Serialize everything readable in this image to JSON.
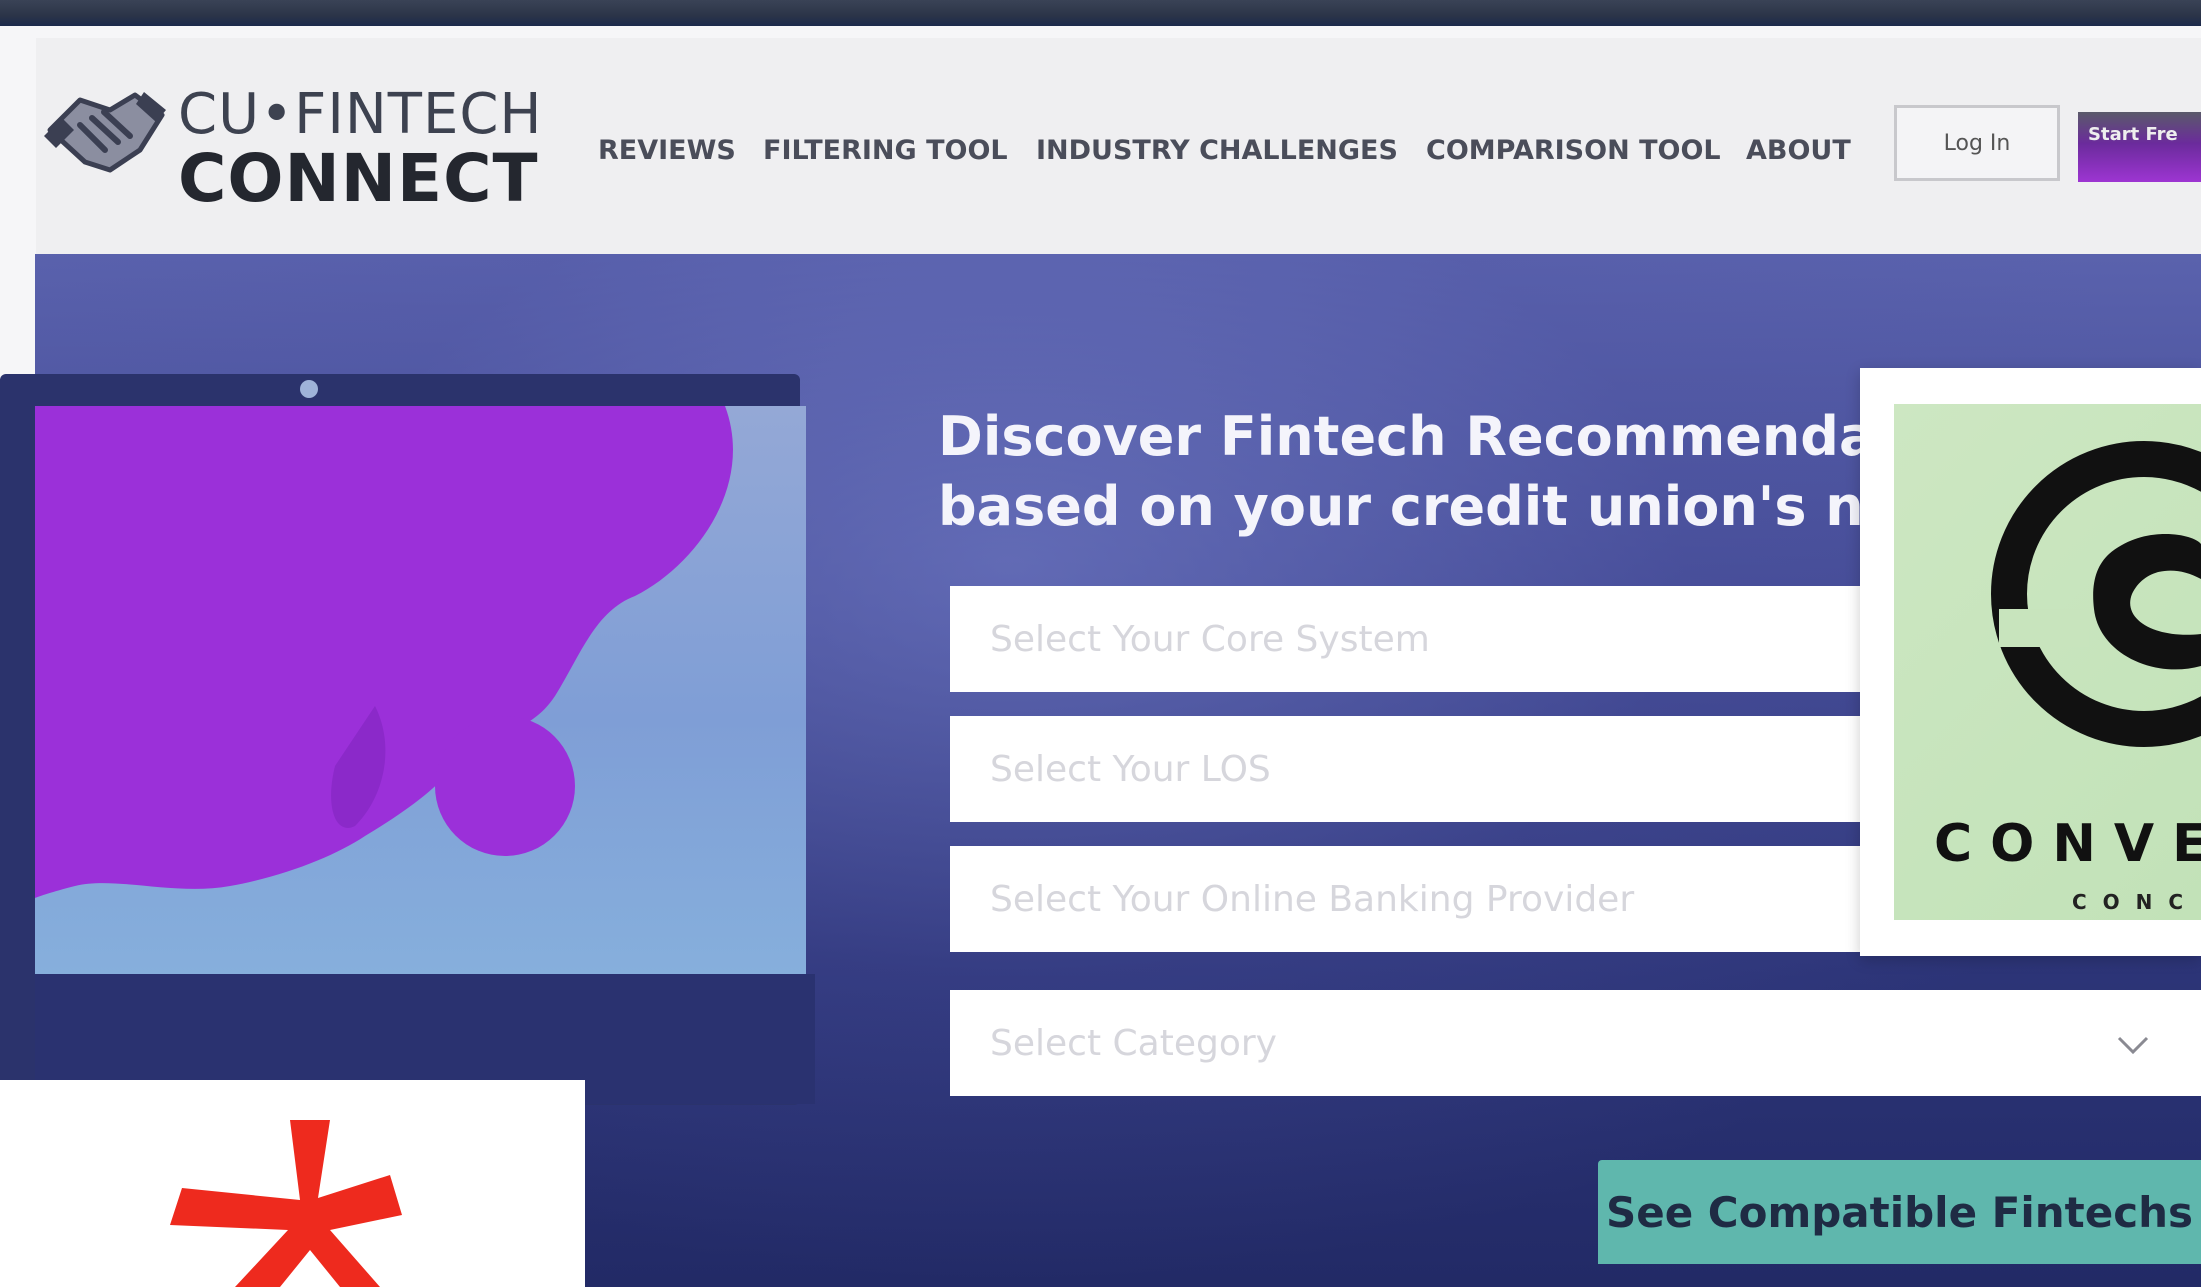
{
  "header": {
    "logo_line1": "CU•FINTECH",
    "logo_line2": "CONNECT",
    "nav": [
      "REVIEWS",
      "FILTERING TOOL",
      "INDUSTRY CHALLENGES",
      "COMPARISON TOOL",
      "ABOUT"
    ],
    "login_label": "Log In",
    "start_label": "Start Fre"
  },
  "hero": {
    "headline_line1": "Discover Fintech Recommendatic",
    "headline_line2": "based on your credit union's neec",
    "fields": [
      {
        "placeholder": "Select Your Core System"
      },
      {
        "placeholder": "Select Your LOS"
      },
      {
        "placeholder": "Select Your Online Banking Provider"
      },
      {
        "placeholder": "Select Category"
      }
    ],
    "cta_label": "See Compatible Fintechs"
  },
  "overlay": {
    "brand_word": "CONVE",
    "brand_sub": "CONC"
  },
  "colors": {
    "accent_purple": "#9b30d9",
    "cta_teal": "#5fb7ad",
    "hero_navy": "#2c3477"
  },
  "icons": [
    "handshake-logo-icon",
    "chevron-down-icon",
    "asterisk-icon",
    "brand-circle-logo-icon"
  ]
}
